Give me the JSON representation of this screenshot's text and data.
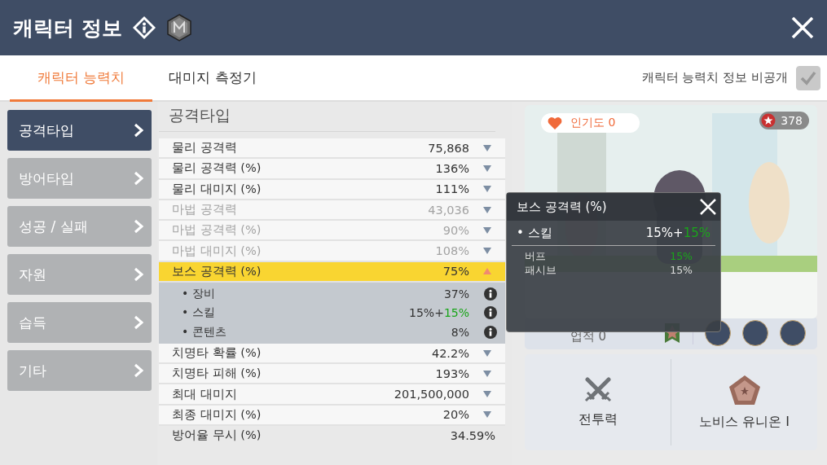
{
  "header": {
    "title": "캐릭터 정보"
  },
  "tabs": [
    {
      "label": "캐릭터 능력치",
      "selected": true
    },
    {
      "label": "대미지 측정기",
      "selected": false
    }
  ],
  "privacy": {
    "label": "캐릭터 능력치 정보 비공개",
    "checked": true
  },
  "sidebar": {
    "items": [
      {
        "label": "공격타입",
        "selected": true
      },
      {
        "label": "방어타입",
        "selected": false
      },
      {
        "label": "성공 / 실패",
        "selected": false
      },
      {
        "label": "자원",
        "selected": false
      },
      {
        "label": "습득",
        "selected": false
      },
      {
        "label": "기타",
        "selected": false
      }
    ]
  },
  "section_title": "공격타입",
  "stats": [
    {
      "label": "물리 공격력",
      "value": "75,868",
      "kind": "expandable",
      "disabled": false,
      "expanded": false
    },
    {
      "label": "물리 공격력 (%)",
      "value": "136%",
      "kind": "expandable",
      "disabled": false,
      "expanded": false
    },
    {
      "label": "물리 대미지 (%)",
      "value": "111%",
      "kind": "expandable",
      "disabled": false,
      "expanded": false
    },
    {
      "label": "마법 공격력",
      "value": "43,036",
      "kind": "expandable",
      "disabled": true,
      "expanded": false
    },
    {
      "label": "마법 공격력 (%)",
      "value": "90%",
      "kind": "expandable",
      "disabled": true,
      "expanded": false
    },
    {
      "label": "마법 대미지 (%)",
      "value": "108%",
      "kind": "expandable",
      "disabled": true,
      "expanded": false
    },
    {
      "label": "보스 공격력 (%)",
      "value": "75%",
      "kind": "expandable",
      "disabled": false,
      "expanded": true,
      "children": [
        {
          "label": "• 장비",
          "value": "37%"
        },
        {
          "label": "• 스킬",
          "value": "15%+",
          "bonus": "15%"
        },
        {
          "label": "• 콘텐츠",
          "value": "8%"
        }
      ]
    },
    {
      "label": "치명타 확률 (%)",
      "value": "42.2%",
      "kind": "expandable",
      "disabled": false,
      "expanded": false
    },
    {
      "label": "치명타 피해 (%)",
      "value": "193%",
      "kind": "expandable",
      "disabled": false,
      "expanded": false
    },
    {
      "label": "최대 대미지",
      "value": "201,500,000",
      "kind": "expandable",
      "disabled": false,
      "expanded": false
    },
    {
      "label": "최종 대미지 (%)",
      "value": "20%",
      "kind": "expandable",
      "disabled": false,
      "expanded": false
    },
    {
      "label": "방어율 무시 (%)",
      "value": "34.59%",
      "kind": "plain"
    }
  ],
  "profile": {
    "popularity": "인기도 0",
    "stars": "378",
    "achievement": "업적 0",
    "cards": [
      {
        "label": "전투력",
        "kind": "swords"
      },
      {
        "label": "노비스 유니온 I",
        "kind": "pentagon"
      }
    ]
  },
  "popup": {
    "title": "보스 공격력 (%)",
    "main": {
      "label": "• 스킬",
      "value": "15%+",
      "bonus": "15%"
    },
    "details": [
      {
        "label": "버프",
        "value": "15%",
        "highlight": true
      },
      {
        "label": "패시브",
        "value": "15%",
        "highlight": false
      }
    ]
  }
}
